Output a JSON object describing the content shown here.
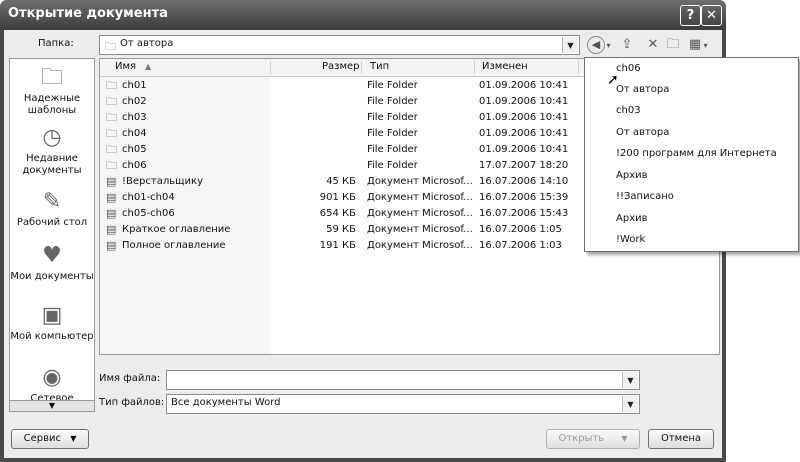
{
  "window": {
    "title": "Открытие документа",
    "help_glyph": "?",
    "close_glyph": "✕"
  },
  "location": {
    "label": "Папка:",
    "value": "От автора"
  },
  "places": [
    {
      "label": "Надежные шаблоны",
      "icon": "trusted-templates-icon"
    },
    {
      "label": "Недавние документы",
      "icon": "recent-documents-icon"
    },
    {
      "label": "Рабочий стол",
      "icon": "desktop-icon"
    },
    {
      "label": "Мои документы",
      "icon": "my-documents-icon"
    },
    {
      "label": "Мой компьютер",
      "icon": "my-computer-icon"
    },
    {
      "label": "Сетевое",
      "icon": "network-icon"
    }
  ],
  "columns": [
    "Имя",
    "Размер",
    "Тип",
    "Изменен"
  ],
  "files": [
    {
      "name": "ch01",
      "size": "",
      "type": "File Folder",
      "modified": "01.09.2006 10:41",
      "icon": "folder-icon"
    },
    {
      "name": "ch02",
      "size": "",
      "type": "File Folder",
      "modified": "01.09.2006 10:41",
      "icon": "folder-icon"
    },
    {
      "name": "ch03",
      "size": "",
      "type": "File Folder",
      "modified": "01.09.2006 10:41",
      "icon": "folder-icon"
    },
    {
      "name": "ch04",
      "size": "",
      "type": "File Folder",
      "modified": "01.09.2006 10:41",
      "icon": "folder-icon"
    },
    {
      "name": "ch05",
      "size": "",
      "type": "File Folder",
      "modified": "01.09.2006 10:41",
      "icon": "folder-icon"
    },
    {
      "name": "ch06",
      "size": "",
      "type": "File Folder",
      "modified": "17.07.2007 18:20",
      "icon": "folder-icon"
    },
    {
      "name": "!Верстальщику",
      "size": "45 КБ",
      "type": "Документ Microsof...",
      "modified": "16.07.2006 14:10",
      "icon": "word-doc-icon"
    },
    {
      "name": "ch01-ch04",
      "size": "901 КБ",
      "type": "Документ Microsof...",
      "modified": "16.07.2006 15:39",
      "icon": "word-doc-icon"
    },
    {
      "name": "ch05-ch06",
      "size": "654 КБ",
      "type": "Документ Microsof...",
      "modified": "16.07.2006 15:43",
      "icon": "word-doc-icon"
    },
    {
      "name": "Краткое оглавление",
      "size": "59 КБ",
      "type": "Документ Microsof...",
      "modified": "16.07.2006 1:05",
      "icon": "word-doc-icon"
    },
    {
      "name": "Полное оглавление",
      "size": "191 КБ",
      "type": "Документ Microsof...",
      "modified": "16.07.2006 1:03",
      "icon": "word-doc-icon"
    }
  ],
  "history_menu": [
    "ch06",
    "От автора",
    "ch03",
    "От автора",
    "!200 программ для Интернета",
    "Архив",
    "!!Записано",
    "Архив",
    "!Work"
  ],
  "filename": {
    "label": "Имя файла:",
    "value": ""
  },
  "filetype": {
    "label": "Тип файлов:",
    "value": "Все документы Word"
  },
  "buttons": {
    "tools": "Сервис",
    "open": "Открыть",
    "cancel": "Отмена"
  }
}
